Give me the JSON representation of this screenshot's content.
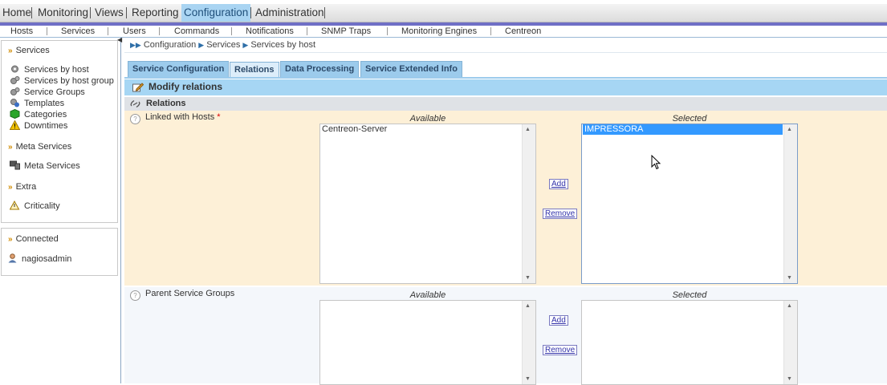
{
  "topnav": {
    "items": [
      "Home",
      "Monitoring",
      "Views",
      "Reporting",
      "Configuration",
      "Administration"
    ],
    "active": "Configuration"
  },
  "subnav": {
    "items": [
      "Hosts",
      "Services",
      "Users",
      "Commands",
      "Notifications",
      "SNMP Traps",
      "Monitoring Engines",
      "Centreon"
    ]
  },
  "sidebar": {
    "services_heading": "Services",
    "service_items": [
      "Services by host",
      "Services by host group",
      "Service Groups",
      "Templates",
      "Categories",
      "Downtimes"
    ],
    "meta_heading": "Meta Services",
    "meta_item": "Meta Services",
    "extra_heading": "Extra",
    "extra_item": "Criticality",
    "connected_heading": "Connected",
    "connected_user": "nagiosadmin"
  },
  "breadcrumb": [
    "Configuration",
    "Services",
    "Services by host"
  ],
  "tabs": [
    "Service Configuration",
    "Relations",
    "Data Processing",
    "Service Extended Info"
  ],
  "active_tab": "Relations",
  "form": {
    "header": "Modify relations",
    "section": "Relations",
    "linked_hosts": {
      "label": "Linked with Hosts",
      "required_mark": "*",
      "available_title": "Available",
      "selected_title": "Selected",
      "available": [
        "Centreon-Server"
      ],
      "selected": [
        "IMPRESSORA"
      ],
      "add_label": "Add",
      "remove_label": "Remove"
    },
    "parent_groups": {
      "label": "Parent Service Groups",
      "available_title": "Available",
      "selected_title": "Selected",
      "available": [],
      "selected": [],
      "add_label": "Add",
      "remove_label": "Remove"
    }
  },
  "colors": {
    "active_tab": "#a9d4f2",
    "accent_bar": "#6f6fc6",
    "selection": "#3399ff",
    "row_highlight": "#fdf0d7"
  }
}
